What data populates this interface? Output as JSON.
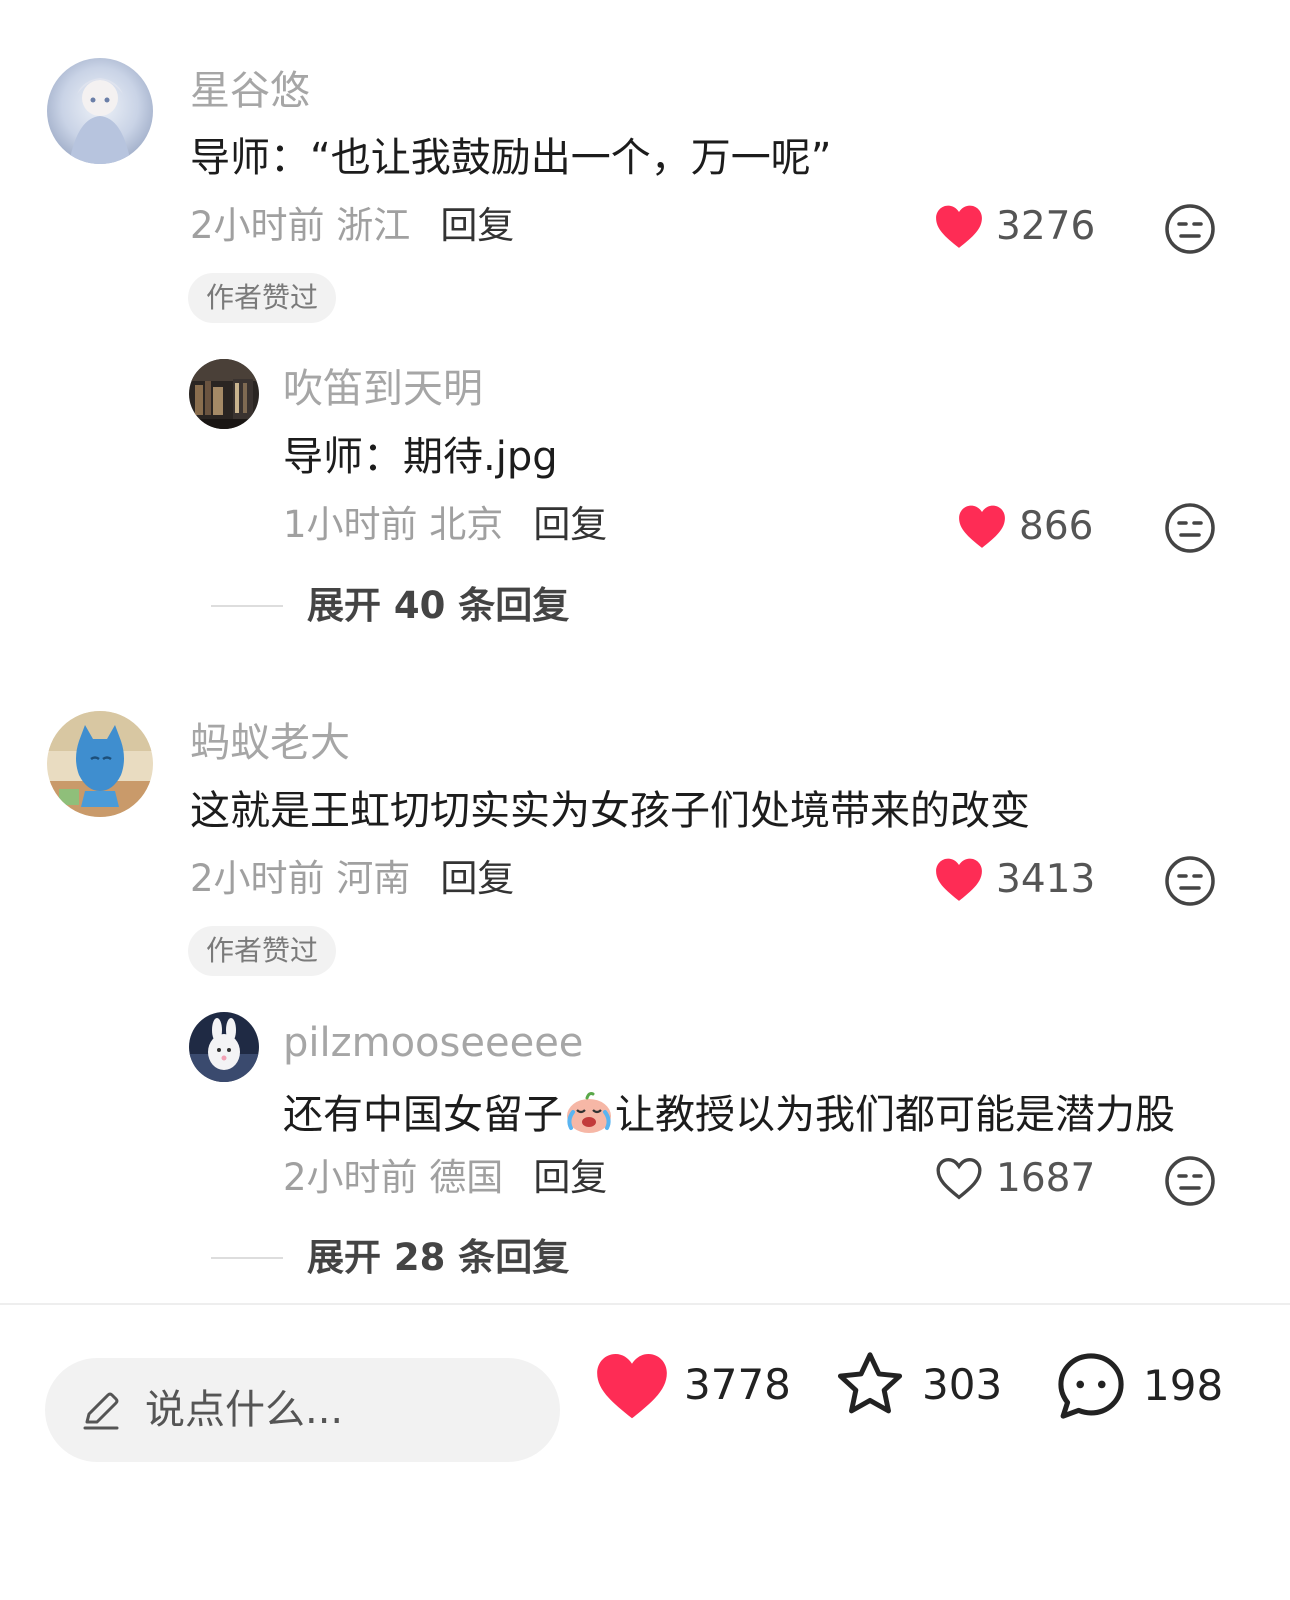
{
  "colors": {
    "like_red": "#fe2c55",
    "muted_text": "#a0a0a0",
    "badge_bg": "#f2f2f2",
    "input_bg": "#f2f2f2"
  },
  "comments": [
    {
      "username": "星谷悠",
      "content": "导师：“也让我鼓励出一个，万一呢”",
      "time_location": "2小时前 浙江",
      "reply_label": "回复",
      "likes": "3276",
      "liked": true,
      "author_badge": "作者赞过",
      "avatar_icon": "avatar-image",
      "reply": {
        "username": "吹笛到天明",
        "content": "导师：期待.jpg",
        "time_location": "1小时前 北京",
        "reply_label": "回复",
        "likes": "866",
        "liked": true,
        "avatar_icon": "avatar-image"
      },
      "expand_label": "展开 40 条回复"
    },
    {
      "username": "蚂蚁老大",
      "content": "这就是王虹切切实实为女孩子们处境带来的改变",
      "time_location": "2小时前 河南",
      "reply_label": "回复",
      "likes": "3413",
      "liked": true,
      "author_badge": "作者赞过",
      "avatar_icon": "avatar-image",
      "reply": {
        "username": "pilzmooseeeee",
        "content_before_emoji": "还有中国女留子",
        "emoji_icon": "crying-face-emoji",
        "content_after_emoji": "让教授以为我们都可能是潜力股",
        "time_location": "2小时前 德国",
        "reply_label": "回复",
        "likes": "1687",
        "liked": false,
        "avatar_icon": "avatar-image"
      },
      "expand_label": "展开 28 条回复"
    }
  ],
  "bottom_bar": {
    "input_placeholder": "说点什么...",
    "input_icon": "pencil-icon",
    "like_count": "3778",
    "star_count": "303",
    "comment_count": "198"
  }
}
